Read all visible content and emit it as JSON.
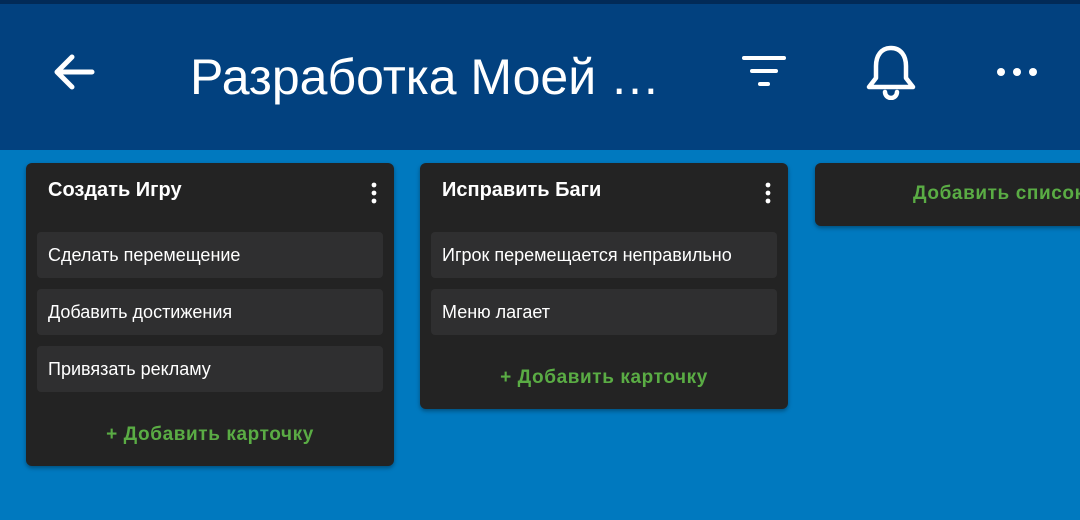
{
  "header": {
    "title": "Разработка Моей …",
    "icons": [
      "arrow-back-icon",
      "filter-icon",
      "bell-icon",
      "more-vertical-dots-icon"
    ]
  },
  "colors": {
    "board_background": "#0079bf",
    "appbar": "#02417f",
    "list_background": "#232323",
    "card_background": "#2f2f30",
    "accent_green": "#5aac44"
  },
  "lists": [
    {
      "title": "Создать Игру",
      "cards": [
        "Сделать перемещение",
        "Добавить достижения",
        "Привязать рекламу"
      ],
      "add_card_label": "+ Добавить карточку"
    },
    {
      "title": "Исправить Баги",
      "cards": [
        "Игрок перемещается неправильно",
        "Меню лагает"
      ],
      "add_card_label": "+ Добавить карточку"
    }
  ],
  "add_list_label": "Добавить список"
}
